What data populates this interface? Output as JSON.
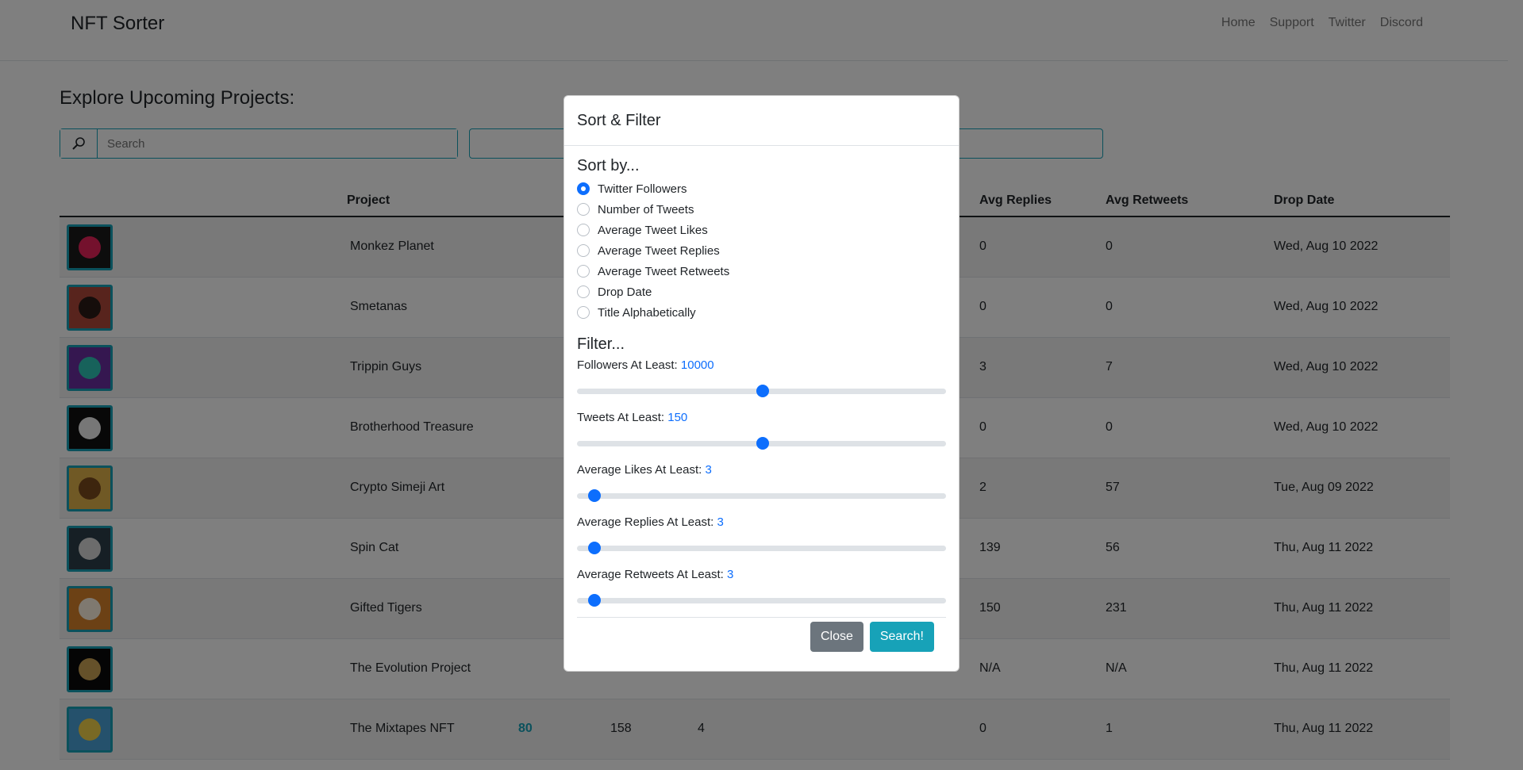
{
  "nav": {
    "brand": "NFT Sorter",
    "links": [
      "Home",
      "Support",
      "Twitter",
      "Discord"
    ]
  },
  "page": {
    "heading": "Explore Upcoming Projects:",
    "search_placeholder": "Search"
  },
  "table": {
    "headers": [
      "Project",
      "Avg Replies",
      "Avg Retweets",
      "Drop Date"
    ],
    "rows": [
      {
        "project": "Monkez Planet",
        "followers": "",
        "tweets": "",
        "likes": "",
        "replies": "0",
        "retweets": "0",
        "date": "Wed, Aug 10 2022"
      },
      {
        "project": "Smetanas",
        "followers": "",
        "tweets": "",
        "likes": "",
        "replies": "0",
        "retweets": "0",
        "date": "Wed, Aug 10 2022"
      },
      {
        "project": "Trippin Guys",
        "followers": "",
        "tweets": "",
        "likes": "",
        "replies": "3",
        "retweets": "7",
        "date": "Wed, Aug 10 2022"
      },
      {
        "project": "Brotherhood Treasure",
        "followers": "",
        "tweets": "",
        "likes": "",
        "replies": "0",
        "retweets": "0",
        "date": "Wed, Aug 10 2022"
      },
      {
        "project": "Crypto Simeji Art",
        "followers": "",
        "tweets": "",
        "likes": "",
        "replies": "2",
        "retweets": "57",
        "date": "Tue, Aug 09 2022"
      },
      {
        "project": "Spin Cat",
        "followers": "",
        "tweets": "",
        "likes": "",
        "replies": "139",
        "retweets": "56",
        "date": "Thu, Aug 11 2022"
      },
      {
        "project": "Gifted Tigers",
        "followers": "",
        "tweets": "",
        "likes": "",
        "replies": "150",
        "retweets": "231",
        "date": "Thu, Aug 11 2022"
      },
      {
        "project": "The Evolution Project",
        "followers": "",
        "tweets": "",
        "likes": "",
        "replies": "N/A",
        "retweets": "N/A",
        "date": "Thu, Aug 11 2022"
      },
      {
        "project": "The Mixtapes NFT",
        "followers": "80",
        "tweets": "158",
        "likes": "4",
        "replies": "0",
        "retweets": "1",
        "date": "Thu, Aug 11 2022"
      }
    ]
  },
  "modal": {
    "title": "Sort & Filter",
    "sort_heading": "Sort by...",
    "sort_options": [
      "Twitter Followers",
      "Number of Tweets",
      "Average Tweet Likes",
      "Average Tweet Replies",
      "Average Tweet Retweets",
      "Drop Date",
      "Title Alphabetically"
    ],
    "sort_selected": "Twitter Followers",
    "filter_heading": "Filter...",
    "filters": [
      {
        "label": "Followers At Least:",
        "value": "10000",
        "level": 0.5
      },
      {
        "label": "Tweets At Least:",
        "value": "150",
        "level": 0.5
      },
      {
        "label": "Average Likes At Least:",
        "value": "3",
        "level": 0.03
      },
      {
        "label": "Average Replies At Least:",
        "value": "3",
        "level": 0.03
      },
      {
        "label": "Average Retweets At Least:",
        "value": "3",
        "level": 0.03
      }
    ],
    "close_label": "Close",
    "search_label": "Search!"
  },
  "colors": {
    "accent": "#17a2b8",
    "primary": "#0d6efd",
    "secondary": "#6c757d"
  }
}
